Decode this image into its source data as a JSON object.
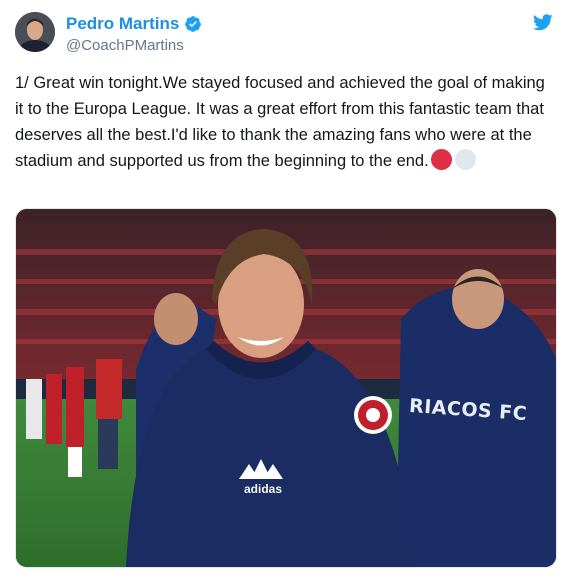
{
  "tweet": {
    "author": {
      "display_name": "Pedro Martins",
      "handle": "@CoachPMartins",
      "verified": true,
      "avatar_icon": "profile-photo"
    },
    "logo_icon": "twitter-bird-icon",
    "text": "1/ Great win tonight.We stayed focused and achieved the goal of making it to the Europa League. It was a great effort from this fantastic team that deserves all the best.I'd like to thank the amazing fans who were at the stadium and supported us from the beginning to the end.",
    "emojis": [
      "red-circle",
      "white-circle"
    ],
    "media": {
      "jacket_text": "RIACOS FC",
      "brand_text": "adidas"
    }
  },
  "colors": {
    "name": "#1d8fe0",
    "handle": "#657786",
    "text": "#14171a",
    "verified": "#1da1f2",
    "bird": "#1da1f2",
    "emoji_red": "#dd2e44",
    "emoji_white": "#e1e8ed"
  }
}
